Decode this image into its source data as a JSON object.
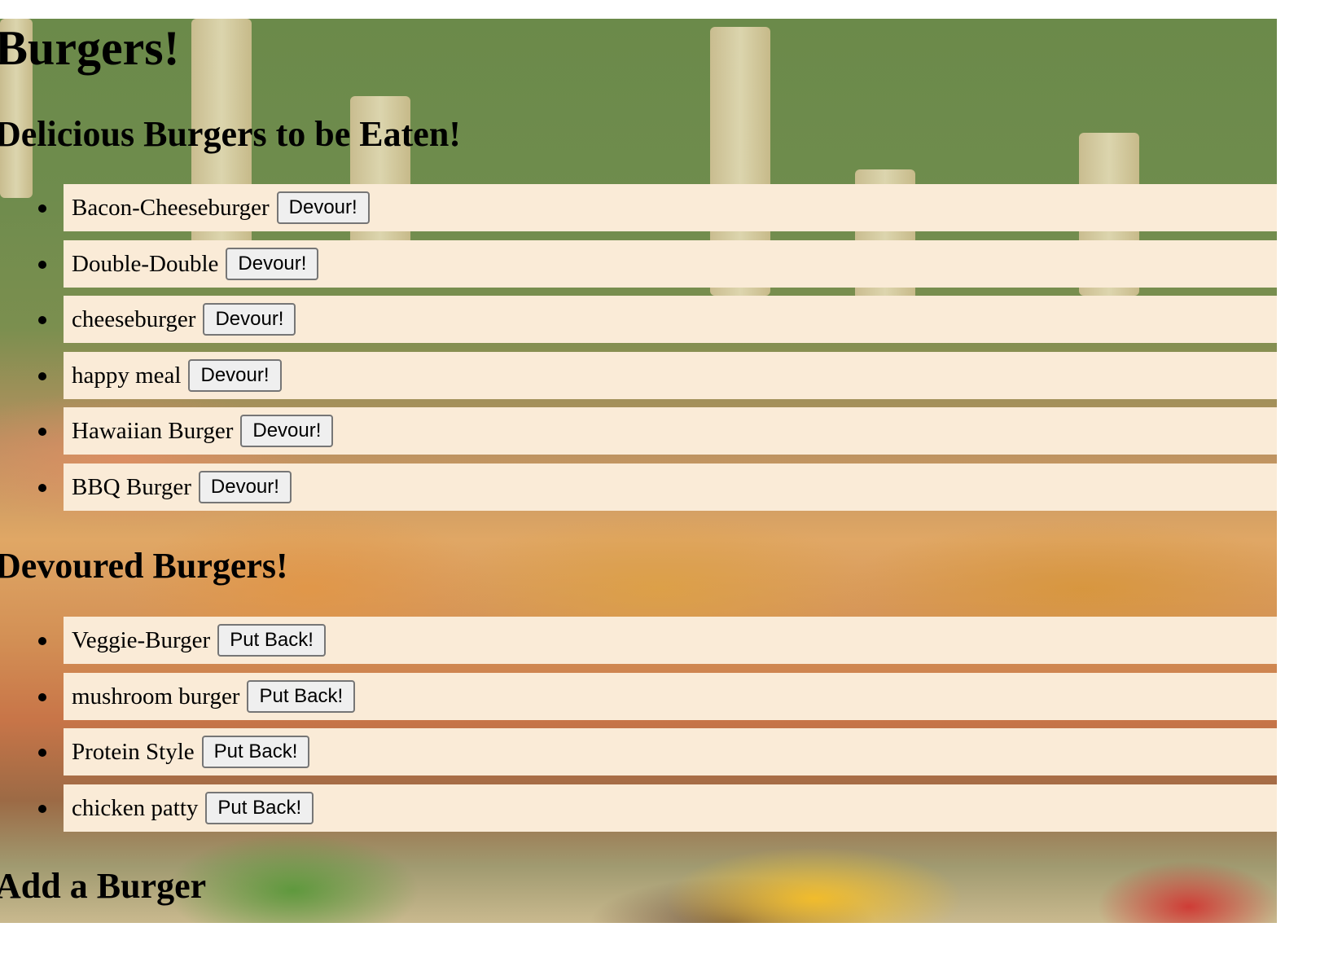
{
  "page": {
    "title": "Burgers!",
    "uneaten_heading": "Delicious Burgers to be Eaten!",
    "devoured_heading": "Devoured Burgers!",
    "add_heading": "Add a Burger"
  },
  "uneaten": [
    {
      "name": "Bacon-Cheeseburger",
      "action": "Devour!"
    },
    {
      "name": "Double-Double",
      "action": "Devour!"
    },
    {
      "name": "cheeseburger",
      "action": "Devour!"
    },
    {
      "name": "happy meal",
      "action": "Devour!"
    },
    {
      "name": "Hawaiian Burger",
      "action": "Devour!"
    },
    {
      "name": "BBQ Burger",
      "action": "Devour!"
    }
  ],
  "devoured": [
    {
      "name": "Veggie-Burger",
      "action": "Put Back!"
    },
    {
      "name": "mushroom burger",
      "action": "Put Back!"
    },
    {
      "name": "Protein Style",
      "action": "Put Back!"
    },
    {
      "name": "chicken patty",
      "action": "Put Back!"
    }
  ],
  "colors": {
    "row_background": "#faebd7",
    "button_background": "#efefef"
  }
}
